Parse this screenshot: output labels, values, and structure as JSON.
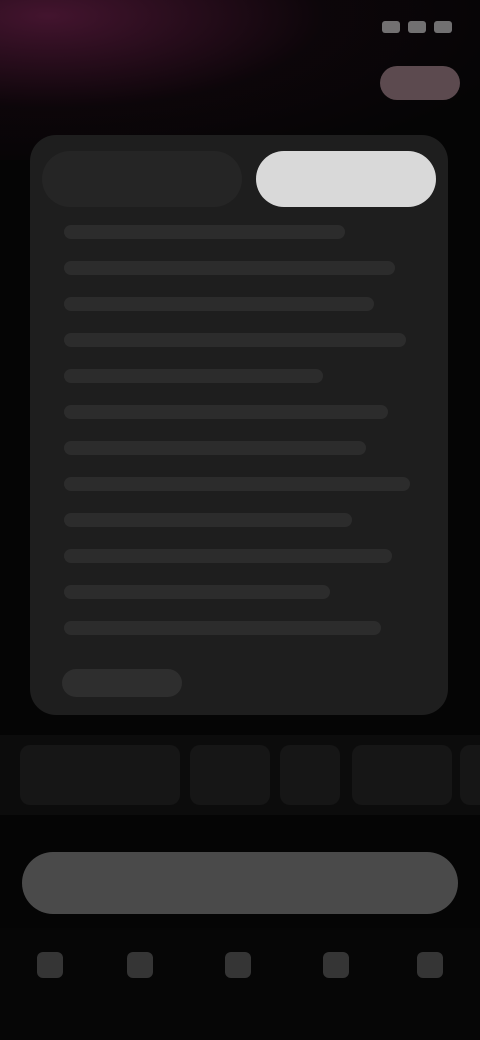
{
  "status_bar": {
    "time": "",
    "icons": [
      "signal-icon",
      "wifi-icon",
      "battery-icon"
    ]
  },
  "header": {
    "title": "",
    "action_label": ""
  },
  "card": {
    "tabs": [
      {
        "label": ""
      },
      {
        "label": ""
      }
    ],
    "footer_label": ""
  },
  "chips": [
    {
      "label": ""
    },
    {
      "label": ""
    },
    {
      "label": ""
    },
    {
      "label": ""
    },
    {
      "label": ""
    }
  ],
  "primary_button": {
    "label": ""
  },
  "bottom_nav": {
    "items": [
      {
        "label": "",
        "icon": "home-icon"
      },
      {
        "label": "",
        "icon": "search-icon"
      },
      {
        "label": "",
        "icon": "add-icon"
      },
      {
        "label": "",
        "icon": "library-icon"
      },
      {
        "label": "",
        "icon": "profile-icon"
      }
    ]
  },
  "colors": {
    "background": "#050505",
    "card": "#1e1e1e",
    "accent_glow": "#58193c",
    "primary_button": "#4a4a4a"
  }
}
